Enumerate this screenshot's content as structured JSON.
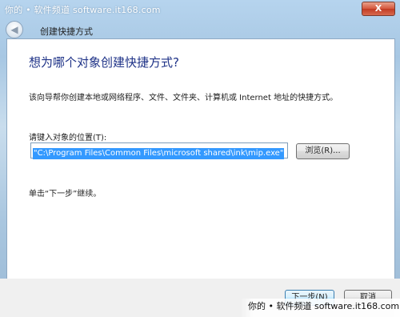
{
  "watermark_top": "你的 • 软件频道  software.it168.com",
  "close_label": "X",
  "nav": {
    "back_glyph": "◀",
    "title": "创建快捷方式"
  },
  "main": {
    "heading": "想为哪个对象创建快捷方式?",
    "description": "该向导帮你创建本地或网络程序、文件、文件夹、计算机或 Internet 地址的快捷方式。",
    "location_label": "请键入对象的位置(T):",
    "location_value": "\"C:\\Program Files\\Common Files\\microsoft shared\\ink\\mip.exe\"",
    "browse_label": "浏览(R)...",
    "hint": "单击“下一步”继续。"
  },
  "footer": {
    "next_label": "下一步(N)",
    "cancel_label": "取消"
  },
  "watermark_bottom": "你的 • 软件频道  software.it168.com",
  "colors": {
    "heading": "#1e3287",
    "selection": "#3399ff",
    "close": "#c13b22"
  }
}
